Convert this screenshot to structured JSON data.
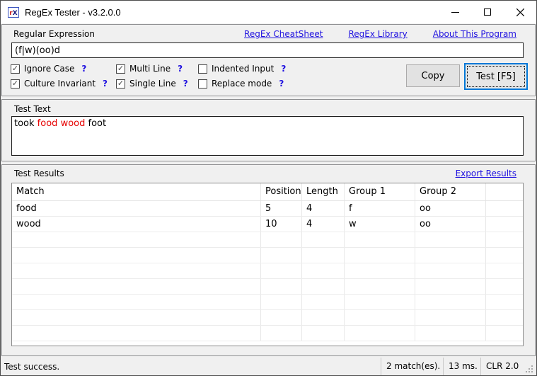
{
  "window": {
    "title": "RegEx Tester - v3.2.0.0",
    "icon_r": "r",
    "icon_x": "X"
  },
  "regex_panel": {
    "label": "Regular Expression",
    "links": [
      {
        "label": "RegEx CheatSheet"
      },
      {
        "label": "RegEx Library"
      },
      {
        "label": "About This Program"
      }
    ],
    "pattern": "(f|w)(oo)d",
    "options": [
      {
        "label": "Ignore Case",
        "checked": true,
        "help": "?"
      },
      {
        "label": "Multi Line",
        "checked": true,
        "help": "?"
      },
      {
        "label": "Indented Input",
        "checked": false,
        "help": "?"
      },
      {
        "label": "Culture Invariant",
        "checked": true,
        "help": "?"
      },
      {
        "label": "Single Line",
        "checked": true,
        "help": "?"
      },
      {
        "label": "Replace mode",
        "checked": false,
        "help": "?"
      }
    ],
    "copy_button": "Copy",
    "test_button": "Test [F5]"
  },
  "test_text_panel": {
    "label": "Test Text",
    "segments": [
      {
        "text": "took ",
        "red": false
      },
      {
        "text": "food",
        "red": true
      },
      {
        "text": " ",
        "red": false
      },
      {
        "text": "wood",
        "red": true
      },
      {
        "text": " foot",
        "red": false
      }
    ]
  },
  "results_panel": {
    "label": "Test Results",
    "export_link": "Export Results",
    "table": {
      "columns": [
        "Match",
        "Position",
        "Length",
        "Group 1",
        "Group 2"
      ],
      "rows": [
        [
          "food",
          "5",
          "4",
          "f",
          "oo"
        ],
        [
          "wood",
          "10",
          "4",
          "w",
          "oo"
        ]
      ],
      "empty_rows": 7
    }
  },
  "status_bar": {
    "message": "Test success.",
    "matches": "2 match(es).",
    "time": "13 ms.",
    "clr": "CLR 2.0"
  },
  "colors": {
    "accent": "#0078d7",
    "link": "#2012e0",
    "help": "#2012e0",
    "match_red": "#e60000",
    "check": "#444444"
  }
}
